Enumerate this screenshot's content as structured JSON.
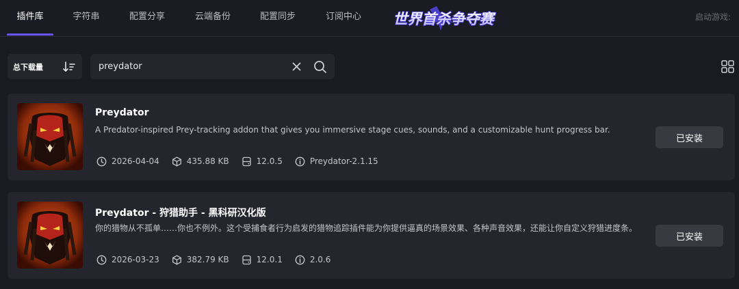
{
  "nav": {
    "tabs": [
      {
        "label": "插件库",
        "active": true
      },
      {
        "label": "字符串",
        "active": false
      },
      {
        "label": "配置分享",
        "active": false
      },
      {
        "label": "云端备份",
        "active": false
      },
      {
        "label": "配置同步",
        "active": false
      },
      {
        "label": "订阅中心",
        "active": false
      }
    ],
    "banner_text": "世界首杀争夺赛",
    "launch_game_label": "启动游戏:"
  },
  "toolbar": {
    "sort_label": "总下载量",
    "search_value": "preydator",
    "sort_icon": "sort-descending-icon",
    "clear_icon": "close-icon",
    "search_icon": "search-icon",
    "view_icon": "grid-view-icon"
  },
  "addons": [
    {
      "title": "Preydator",
      "description": "A Predator-inspired Prey-tracking addon that gives you immersive stage cues, sounds, and a customizable hunt progress bar.",
      "date": "2026-04-04",
      "size": "435.88 KB",
      "game_version": "12.0.5",
      "version": "Preydator-2.1.15",
      "action_label": "已安装"
    },
    {
      "title": "Preydator - 狩猎助手 - 黑科研汉化版",
      "description": "你的猎物从不孤单……你也不例外。这个受捕食者行为启发的猎物追踪插件能为你提供逼真的场景效果、各种声音效果，还能让你自定义狩猎进度条。",
      "date": "2026-03-23",
      "size": "382.79 KB",
      "game_version": "12.0.1",
      "version": "2.0.6",
      "action_label": "已安装"
    }
  ],
  "colors": {
    "background": "#1a1a21",
    "card": "#25252d",
    "accent": "#6a55ff",
    "button": "#393942"
  }
}
